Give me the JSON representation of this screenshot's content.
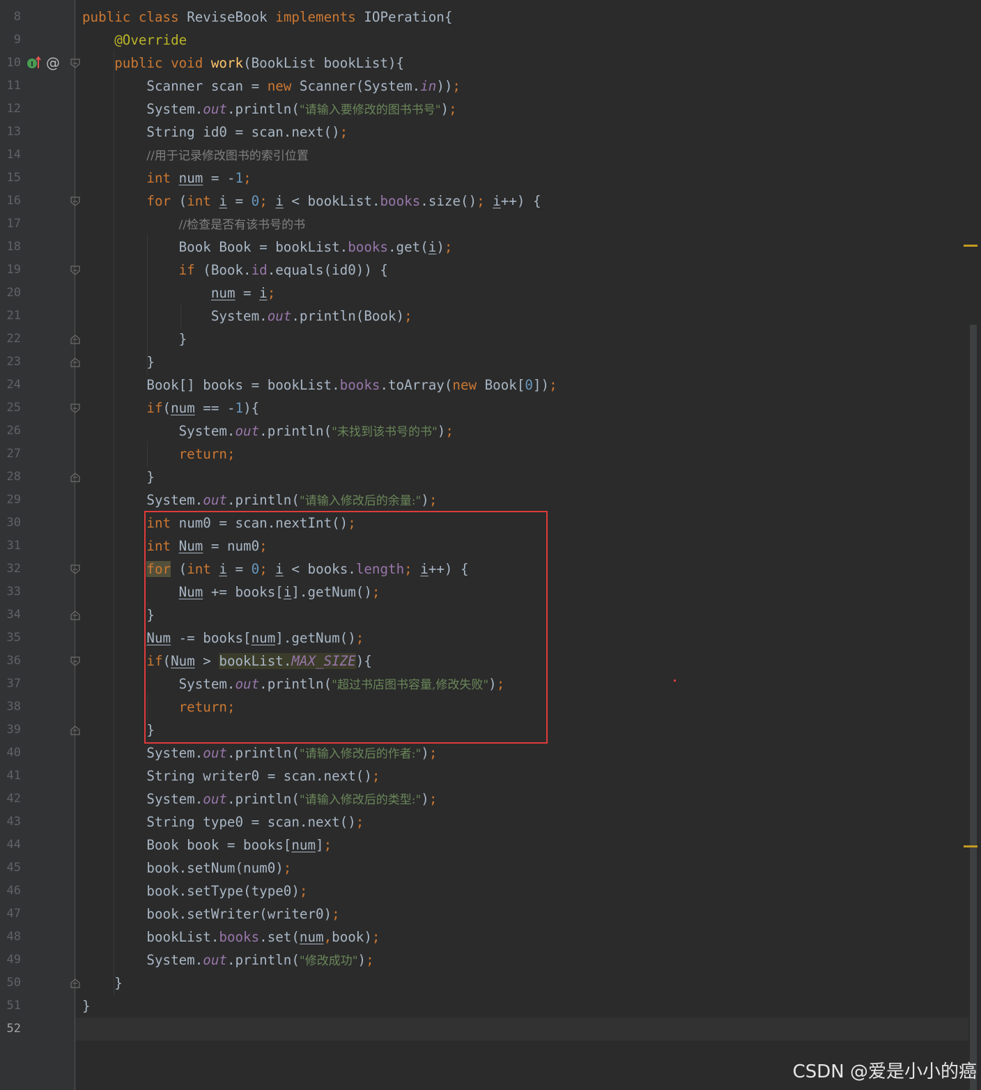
{
  "editor": {
    "current_line": 52,
    "watermark": "CSDN @爱是小小的癌"
  },
  "gutter": {
    "override_icon": "implements-method-icon",
    "at_icon": "@"
  },
  "lines": [
    {
      "n": "8",
      "t": [
        [
          "kw",
          "public class "
        ],
        [
          "",
          "ReviseBook "
        ],
        [
          "kw",
          "implements "
        ],
        [
          "",
          "IOPeration{"
        ]
      ]
    },
    {
      "n": "9",
      "t": [
        [
          "",
          "    "
        ],
        [
          "an",
          "@Override"
        ]
      ]
    },
    {
      "n": "10",
      "t": [
        [
          "",
          "    "
        ],
        [
          "kw",
          "public void "
        ],
        [
          "fn",
          "work"
        ],
        [
          "",
          "(BookList bookList){"
        ]
      ]
    },
    {
      "n": "11",
      "t": [
        [
          "",
          "        Scanner scan = "
        ],
        [
          "kw",
          "new "
        ],
        [
          "",
          "Scanner(System."
        ],
        [
          "sfld",
          "in"
        ],
        [
          "",
          "))"
        ],
        [
          "punc",
          ";"
        ]
      ]
    },
    {
      "n": "12",
      "t": [
        [
          "",
          "        System."
        ],
        [
          "sfld",
          "out"
        ],
        [
          "",
          ".println("
        ],
        [
          "str",
          "\"请输入要修改的图书书号\""
        ],
        [
          "",
          ")"
        ],
        [
          "punc",
          ";"
        ]
      ]
    },
    {
      "n": "13",
      "t": [
        [
          "",
          "        String id0 = scan.next()"
        ],
        [
          "punc",
          ";"
        ]
      ]
    },
    {
      "n": "14",
      "t": [
        [
          "",
          "        "
        ],
        [
          "cm",
          "//用于记录修改图书的索引位置"
        ]
      ]
    },
    {
      "n": "15",
      "t": [
        [
          "",
          "        "
        ],
        [
          "kw",
          "int "
        ],
        [
          "u",
          "num"
        ],
        [
          "",
          " = -"
        ],
        [
          "num",
          "1"
        ],
        [
          "punc",
          ";"
        ]
      ]
    },
    {
      "n": "16",
      "t": [
        [
          "",
          "        "
        ],
        [
          "kw",
          "for "
        ],
        [
          "",
          "("
        ],
        [
          "kw",
          "int "
        ],
        [
          "u",
          "i"
        ],
        [
          "",
          " = "
        ],
        [
          "num",
          "0"
        ],
        [
          "punc",
          "; "
        ],
        [
          "u",
          "i"
        ],
        [
          "",
          " < bookList."
        ],
        [
          "fld",
          "books"
        ],
        [
          "",
          ".size()"
        ],
        [
          "punc",
          "; "
        ],
        [
          "u",
          "i"
        ],
        [
          "",
          "++) {"
        ]
      ]
    },
    {
      "n": "17",
      "t": [
        [
          "",
          "            "
        ],
        [
          "cm",
          "//检查是否有该书号的书"
        ]
      ]
    },
    {
      "n": "18",
      "t": [
        [
          "",
          "            Book Book = bookList."
        ],
        [
          "fld",
          "books"
        ],
        [
          "",
          ".get("
        ],
        [
          "u",
          "i"
        ],
        [
          "",
          ")"
        ],
        [
          "punc",
          ";"
        ]
      ]
    },
    {
      "n": "19",
      "t": [
        [
          "",
          "            "
        ],
        [
          "kw",
          "if "
        ],
        [
          "",
          "(Book."
        ],
        [
          "fld",
          "id"
        ],
        [
          "",
          ".equals(id0)) {"
        ]
      ]
    },
    {
      "n": "20",
      "t": [
        [
          "",
          "                "
        ],
        [
          "u",
          "num"
        ],
        [
          "",
          " = "
        ],
        [
          "u",
          "i"
        ],
        [
          "punc",
          ";"
        ]
      ]
    },
    {
      "n": "21",
      "t": [
        [
          "",
          "                System."
        ],
        [
          "sfld",
          "out"
        ],
        [
          "",
          ".println(Book)"
        ],
        [
          "punc",
          ";"
        ]
      ]
    },
    {
      "n": "22",
      "t": [
        [
          "",
          "            }"
        ]
      ]
    },
    {
      "n": "23",
      "t": [
        [
          "",
          "        }"
        ]
      ]
    },
    {
      "n": "24",
      "t": [
        [
          "",
          "        Book[] books = bookList."
        ],
        [
          "fld",
          "books"
        ],
        [
          "",
          ".toArray("
        ],
        [
          "kw",
          "new "
        ],
        [
          "",
          "Book["
        ],
        [
          "num",
          "0"
        ],
        [
          "",
          "])"
        ],
        [
          "punc",
          ";"
        ]
      ]
    },
    {
      "n": "25",
      "t": [
        [
          "",
          "        "
        ],
        [
          "kw",
          "if"
        ],
        [
          "",
          "("
        ],
        [
          "u",
          "num"
        ],
        [
          "",
          " == -"
        ],
        [
          "num",
          "1"
        ],
        [
          "",
          "){"
        ]
      ]
    },
    {
      "n": "26",
      "t": [
        [
          "",
          "            System."
        ],
        [
          "sfld",
          "out"
        ],
        [
          "",
          ".println("
        ],
        [
          "str",
          "\"未找到该书号的书\""
        ],
        [
          "",
          ")"
        ],
        [
          "punc",
          ";"
        ]
      ]
    },
    {
      "n": "27",
      "t": [
        [
          "",
          "            "
        ],
        [
          "kw",
          "return"
        ],
        [
          "punc",
          ";"
        ]
      ]
    },
    {
      "n": "28",
      "t": [
        [
          "",
          "        }"
        ]
      ]
    },
    {
      "n": "29",
      "t": [
        [
          "",
          "        System."
        ],
        [
          "sfld",
          "out"
        ],
        [
          "",
          ".println("
        ],
        [
          "str",
          "\"请输入修改后的余量:\""
        ],
        [
          "",
          ")"
        ],
        [
          "punc",
          ";"
        ]
      ]
    },
    {
      "n": "30",
      "t": [
        [
          "",
          "        "
        ],
        [
          "kw",
          "int "
        ],
        [
          "",
          "num0 = scan.nextInt()"
        ],
        [
          "punc",
          ";"
        ]
      ]
    },
    {
      "n": "31",
      "t": [
        [
          "",
          "        "
        ],
        [
          "kw",
          "int "
        ],
        [
          "u",
          "Num"
        ],
        [
          "",
          " = num0"
        ],
        [
          "punc",
          ";"
        ]
      ]
    },
    {
      "n": "32",
      "t": [
        [
          "",
          "        "
        ],
        [
          "kw hl-for",
          "for"
        ],
        [
          "",
          " ("
        ],
        [
          "kw",
          "int "
        ],
        [
          "u",
          "i"
        ],
        [
          "",
          " = "
        ],
        [
          "num",
          "0"
        ],
        [
          "punc",
          "; "
        ],
        [
          "u",
          "i"
        ],
        [
          "",
          " < books."
        ],
        [
          "fld",
          "length"
        ],
        [
          "punc",
          "; "
        ],
        [
          "u",
          "i"
        ],
        [
          "",
          "++) {"
        ]
      ]
    },
    {
      "n": "33",
      "t": [
        [
          "",
          "            "
        ],
        [
          "u",
          "Num"
        ],
        [
          "",
          " += books["
        ],
        [
          "u",
          "i"
        ],
        [
          "",
          "].getNum()"
        ],
        [
          "punc",
          ";"
        ]
      ]
    },
    {
      "n": "34",
      "t": [
        [
          "",
          "        }"
        ]
      ]
    },
    {
      "n": "35",
      "t": [
        [
          "",
          "        "
        ],
        [
          "u",
          "Num"
        ],
        [
          "",
          " -= books["
        ],
        [
          "u",
          "num"
        ],
        [
          "",
          "].getNum()"
        ],
        [
          "punc",
          ";"
        ]
      ]
    },
    {
      "n": "36",
      "t": [
        [
          "",
          "        "
        ],
        [
          "kw",
          "if"
        ],
        [
          "",
          "("
        ],
        [
          "u",
          "Num"
        ],
        [
          "",
          " > "
        ],
        [
          "hl-ref",
          "bookList."
        ],
        [
          "sfld hl-ref",
          "MAX_SIZE"
        ],
        [
          "",
          "){"
        ]
      ]
    },
    {
      "n": "37",
      "t": [
        [
          "",
          "            System."
        ],
        [
          "sfld",
          "out"
        ],
        [
          "",
          ".println("
        ],
        [
          "str",
          "\"超过书店图书容量,修改失败\""
        ],
        [
          "",
          ")"
        ],
        [
          "punc",
          ";"
        ]
      ]
    },
    {
      "n": "38",
      "t": [
        [
          "",
          "            "
        ],
        [
          "kw",
          "return"
        ],
        [
          "punc",
          ";"
        ]
      ]
    },
    {
      "n": "39",
      "t": [
        [
          "",
          "        }"
        ]
      ]
    },
    {
      "n": "40",
      "t": [
        [
          "",
          "        System."
        ],
        [
          "sfld",
          "out"
        ],
        [
          "",
          ".println("
        ],
        [
          "str",
          "\"请输入修改后的作者:\""
        ],
        [
          "",
          ")"
        ],
        [
          "punc",
          ";"
        ]
      ]
    },
    {
      "n": "41",
      "t": [
        [
          "",
          "        String writer0 = scan.next()"
        ],
        [
          "punc",
          ";"
        ]
      ]
    },
    {
      "n": "42",
      "t": [
        [
          "",
          "        System."
        ],
        [
          "sfld",
          "out"
        ],
        [
          "",
          ".println("
        ],
        [
          "str",
          "\"请输入修改后的类型:\""
        ],
        [
          "",
          ")"
        ],
        [
          "punc",
          ";"
        ]
      ]
    },
    {
      "n": "43",
      "t": [
        [
          "",
          "        String type0 = scan.next()"
        ],
        [
          "punc",
          ";"
        ]
      ]
    },
    {
      "n": "44",
      "t": [
        [
          "",
          "        Book book = books["
        ],
        [
          "u",
          "num"
        ],
        [
          "",
          "]"
        ],
        [
          "punc",
          ";"
        ]
      ]
    },
    {
      "n": "45",
      "t": [
        [
          "",
          "        book.setNum(num0)"
        ],
        [
          "punc",
          ";"
        ]
      ]
    },
    {
      "n": "46",
      "t": [
        [
          "",
          "        book.setType(type0)"
        ],
        [
          "punc",
          ";"
        ]
      ]
    },
    {
      "n": "47",
      "t": [
        [
          "",
          "        book.setWriter(writer0)"
        ],
        [
          "punc",
          ";"
        ]
      ]
    },
    {
      "n": "48",
      "t": [
        [
          "",
          "        bookList."
        ],
        [
          "fld",
          "books"
        ],
        [
          "",
          ".set("
        ],
        [
          "u",
          "num"
        ],
        [
          "punc",
          ","
        ],
        [
          "",
          "book)"
        ],
        [
          "punc",
          ";"
        ]
      ]
    },
    {
      "n": "49",
      "t": [
        [
          "",
          "        System."
        ],
        [
          "sfld",
          "out"
        ],
        [
          "",
          ".println("
        ],
        [
          "str",
          "\"修改成功\""
        ],
        [
          "",
          ")"
        ],
        [
          "punc",
          ";"
        ]
      ]
    },
    {
      "n": "50",
      "t": [
        [
          "",
          "    }"
        ]
      ]
    },
    {
      "n": "51",
      "t": [
        [
          "",
          "}"
        ]
      ]
    },
    {
      "n": "52",
      "t": []
    }
  ],
  "folds": [
    {
      "line": "10",
      "kind": "open"
    },
    {
      "line": "16",
      "kind": "open"
    },
    {
      "line": "19",
      "kind": "open"
    },
    {
      "line": "22",
      "kind": "close"
    },
    {
      "line": "23",
      "kind": "close"
    },
    {
      "line": "25",
      "kind": "open"
    },
    {
      "line": "28",
      "kind": "close"
    },
    {
      "line": "32",
      "kind": "open"
    },
    {
      "line": "34",
      "kind": "close"
    },
    {
      "line": "36",
      "kind": "open"
    },
    {
      "line": "39",
      "kind": "close"
    },
    {
      "line": "50",
      "kind": "close"
    }
  ],
  "colors": {
    "background": "#2b2b2b",
    "keyword": "#cc7832",
    "string": "#6a8759",
    "comment": "#808080",
    "field": "#9876aa",
    "number": "#6897bb",
    "highlight_box": "#e03b3b"
  }
}
